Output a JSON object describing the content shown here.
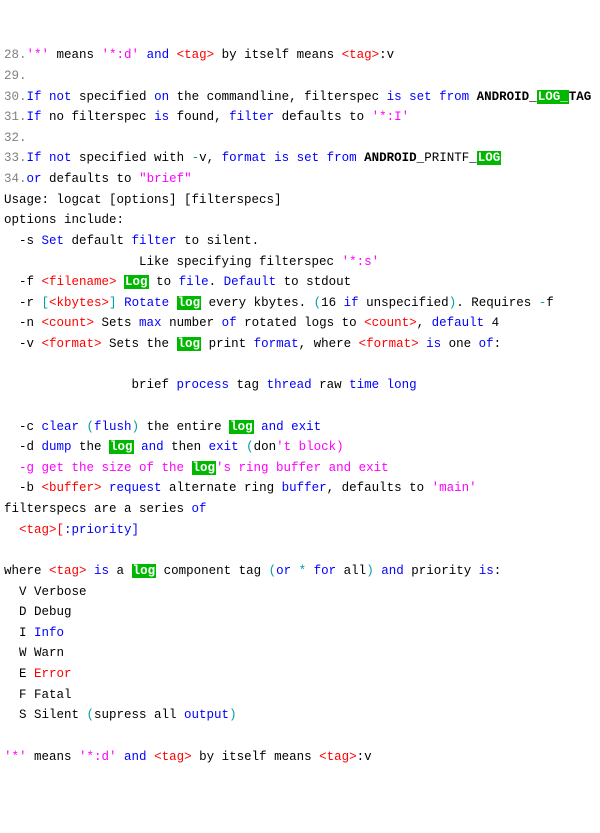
{
  "lines": {
    "l28a": "28.",
    "l28b": "'*'",
    "l28c": " means ",
    "l28d": "'*:d'",
    "l28e": " and ",
    "l28f": "<tag>",
    "l28g": " by itself means ",
    "l28h": "<tag>",
    "l28i": ":v",
    "l29a": "29.",
    "l30a": "30.",
    "l30b": "If",
    "l30c": " not",
    "l30d": " specified ",
    "l30e": "on",
    "l30f": " the commandline, filterspec ",
    "l30g": "is",
    "l30h": " set",
    "l30i": " from ",
    "l30j": "ANDROID_",
    "l30k": "LOG_",
    "l30l": "TAG",
    "l31a": "31.",
    "l31b": "If",
    "l31c": " no filterspec ",
    "l31d": "is",
    "l31e": " found, ",
    "l31f": "filter",
    "l31g": " defaults to ",
    "l31h": "'*:I'",
    "l32a": "32.",
    "l33a": "33.",
    "l33b": "If",
    "l33c": " not",
    "l33d": " specified with ",
    "l33e": "-",
    "l33f": "v, ",
    "l33g": "format",
    "l33h": " is",
    "l33i": " set",
    "l33j": " from ",
    "l33k": "ANDROID_",
    "l33l": "PRINTF_",
    "l33m": "LOG",
    "l34a": "34.",
    "l34b": "or",
    "l34c": " defaults to ",
    "l34d": "\"brief\"",
    "u1": "Usage: logcat [options] [filterspecs]",
    "u2": "options include:",
    "s1a": "  -s ",
    "s1b": "Set",
    "s1c": " default ",
    "s1d": "filter",
    "s1e": " to silent.",
    "s2a": "                  Like specifying filterspec ",
    "s2b": "'*:s'",
    "f1a": "  -f ",
    "f1b": "<filename>",
    "f1c": " ",
    "f1d": "Log",
    "f1e": " to ",
    "f1f": "file",
    "f1g": ". ",
    "f1h": "Default",
    "f1i": " to stdout",
    "r1a": "  -r ",
    "r1b": "[",
    "r1c": "<kbytes>",
    "r1d": "]",
    "r1e": " Rotate ",
    "r1f": "log",
    "r1g": " every kbytes. ",
    "r1h": "(",
    "r1i": "16 ",
    "r1j": "if",
    "r1k": " unspecified",
    "r1l": ")",
    "r1m": ". Requires ",
    "r1n": "-",
    "r1o": "f",
    "n1a": "  -n ",
    "n1b": "<count>",
    "n1c": " Sets ",
    "n1d": "max",
    "n1e": " number ",
    "n1f": "of",
    "n1g": " rotated logs to ",
    "n1h": "<count>",
    "n1i": ", ",
    "n1j": "default",
    "n1k": " 4",
    "v1a": "  -v ",
    "v1b": "<format>",
    "v1c": " Sets the ",
    "v1d": "log",
    "v1e": " print ",
    "v1f": "format",
    "v1g": ", where ",
    "v1h": "<format>",
    "v1i": " is",
    "v1j": " one ",
    "v1k": "of",
    "v1l": ":",
    "bp1a": "                 brief ",
    "bp1b": "process",
    "bp1c": " tag ",
    "bp1d": "thread",
    "bp1e": " raw ",
    "bp1f": "time",
    "bp1g": " long",
    "c1a": "  -c ",
    "c1b": "clear",
    "c1c": " (",
    "c1d": "flush",
    "c1e": ")",
    "c1f": " the entire ",
    "c1g": "log",
    "c1h": " and",
    "c1i": " exit",
    "d1a": "  -d ",
    "d1b": "dump",
    "d1c": " the ",
    "d1d": "log",
    "d1e": " and",
    "d1f": " then ",
    "d1g": "exit",
    "d1h": " (",
    "d1i": "don",
    "d1j": "'t block)",
    "g1a": "  -g get the size of the ",
    "g1b": "log",
    "g1c": "'s ring buffer and exit",
    "b1a": "  -b ",
    "b1b": "<buffer>",
    "b1c": " request",
    "b1d": " alternate ring ",
    "b1e": "buffer",
    "b1f": ", defaults to ",
    "b1g": "'main'",
    "fs1a": "filterspecs are a series ",
    "fs1b": "of",
    "tp1a": "  <tag>[",
    "tp1b": ":priority]",
    "wh1a": "where ",
    "wh1b": "<tag>",
    "wh1c": " is",
    "wh1d": " a ",
    "wh1e": "log",
    "wh1f": " component tag ",
    "wh1g": "(",
    "wh1h": "or",
    "wh1i": " *",
    "wh1j": " for",
    "wh1k": " all",
    "wh1l": ")",
    "wh1m": " and",
    "wh1n": " priority ",
    "wh1o": "is",
    "wh1p": ":",
    "pv": "  V Verbose",
    "pd": "  D Debug",
    "pi1": "  I ",
    "pi2": "Info",
    "pw": "  W Warn",
    "pe1": "  E ",
    "pe2": "Error",
    "pf": "  F Fatal",
    "ps1": "  S Silent ",
    "ps2": "(",
    "ps3": "supress all ",
    "ps4": "output",
    "ps5": ")",
    "ft1": "'*'",
    "ft2": " means ",
    "ft3": "'*:d'",
    "ft4": " and ",
    "ft5": "<tag>",
    "ft6": " by itself means ",
    "ft7": "<tag>",
    "ft8": ":v"
  }
}
